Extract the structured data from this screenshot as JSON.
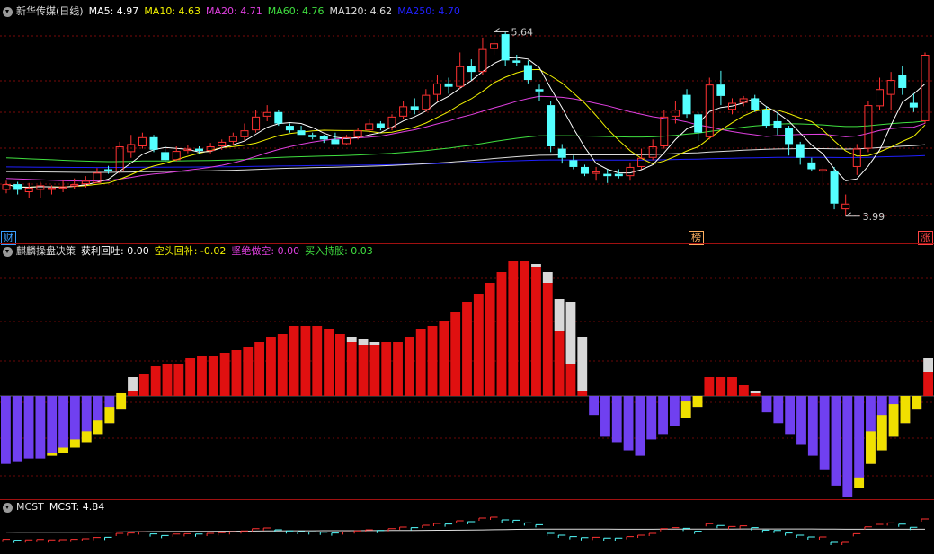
{
  "main_chart": {
    "title": "新华传媒(日线)",
    "indicators": [
      {
        "label": "MA5: 4.97",
        "color": "#ffffff"
      },
      {
        "label": "MA10: 4.63",
        "color": "#f2f200"
      },
      {
        "label": "MA20: 4.71",
        "color": "#e040e0"
      },
      {
        "label": "MA60: 4.76",
        "color": "#40e040"
      },
      {
        "label": "MA120: 4.62",
        "color": "#dddddd"
      },
      {
        "label": "MA250: 4.70",
        "color": "#2020ff"
      }
    ],
    "price_scale": [
      3.8,
      5.8
    ],
    "high_label": "5.64",
    "low_label": "3.99",
    "markers": [
      {
        "label": "财",
        "color": "#3aa0ff"
      },
      {
        "label": "榜",
        "color": "#ffb060"
      },
      {
        "label": "涨",
        "color": "#ff4444"
      }
    ],
    "candles": [
      [
        4.22,
        4.27,
        4.19,
        4.3
      ],
      [
        4.27,
        4.22,
        4.18,
        4.29
      ],
      [
        4.2,
        4.24,
        4.15,
        4.28
      ],
      [
        4.22,
        4.26,
        4.15,
        4.29
      ],
      [
        4.22,
        4.24,
        4.18,
        4.26
      ],
      [
        4.23,
        4.25,
        4.2,
        4.3
      ],
      [
        4.25,
        4.27,
        4.23,
        4.32
      ],
      [
        4.27,
        4.3,
        4.24,
        4.34
      ],
      [
        4.28,
        4.37,
        4.28,
        4.41
      ],
      [
        4.4,
        4.38,
        4.36,
        4.43
      ],
      [
        4.38,
        4.6,
        4.36,
        4.64
      ],
      [
        4.55,
        4.62,
        4.5,
        4.7
      ],
      [
        4.6,
        4.68,
        4.58,
        4.72
      ],
      [
        4.68,
        4.57,
        4.55,
        4.7
      ],
      [
        4.55,
        4.48,
        4.46,
        4.6
      ],
      [
        4.48,
        4.56,
        4.47,
        4.6
      ],
      [
        4.56,
        4.58,
        4.54,
        4.61
      ],
      [
        4.58,
        4.56,
        4.54,
        4.6
      ],
      [
        4.56,
        4.6,
        4.54,
        4.63
      ],
      [
        4.6,
        4.64,
        4.57,
        4.66
      ],
      [
        4.64,
        4.69,
        4.61,
        4.72
      ],
      [
        4.68,
        4.74,
        4.65,
        4.8
      ],
      [
        4.74,
        4.86,
        4.72,
        4.92
      ],
      [
        4.86,
        4.9,
        4.82,
        4.96
      ],
      [
        4.9,
        4.8,
        4.78,
        4.92
      ],
      [
        4.78,
        4.74,
        4.72,
        4.8
      ],
      [
        4.74,
        4.7,
        4.7,
        4.78
      ],
      [
        4.7,
        4.68,
        4.66,
        4.72
      ],
      [
        4.69,
        4.66,
        4.63,
        4.7
      ],
      [
        4.66,
        4.62,
        4.62,
        4.72
      ],
      [
        4.62,
        4.68,
        4.61,
        4.7
      ],
      [
        4.68,
        4.74,
        4.66,
        4.76
      ],
      [
        4.74,
        4.8,
        4.72,
        4.84
      ],
      [
        4.8,
        4.76,
        4.74,
        4.82
      ],
      [
        4.76,
        4.86,
        4.74,
        4.88
      ],
      [
        4.86,
        4.95,
        4.84,
        5.0
      ],
      [
        4.95,
        4.92,
        4.88,
        5.02
      ],
      [
        4.92,
        5.05,
        4.9,
        5.1
      ],
      [
        5.05,
        5.15,
        5.0,
        5.22
      ],
      [
        5.15,
        5.12,
        5.06,
        5.2
      ],
      [
        5.12,
        5.3,
        5.1,
        5.42
      ],
      [
        5.3,
        5.25,
        5.18,
        5.36
      ],
      [
        5.25,
        5.45,
        5.22,
        5.55
      ],
      [
        5.45,
        5.5,
        5.4,
        5.6
      ],
      [
        5.58,
        5.35,
        5.3,
        5.6
      ],
      [
        5.35,
        5.33,
        5.3,
        5.4
      ],
      [
        5.31,
        5.18,
        5.15,
        5.35
      ],
      [
        5.1,
        5.08,
        5.0,
        5.14
      ],
      [
        4.96,
        4.6,
        4.55,
        5.0
      ],
      [
        4.58,
        4.5,
        4.45,
        4.62
      ],
      [
        4.48,
        4.42,
        4.4,
        4.52
      ],
      [
        4.42,
        4.36,
        4.34,
        4.44
      ],
      [
        4.36,
        4.38,
        4.3,
        4.42
      ],
      [
        4.36,
        4.34,
        4.28,
        4.4
      ],
      [
        4.36,
        4.34,
        4.32,
        4.4
      ],
      [
        4.34,
        4.42,
        4.3,
        4.46
      ],
      [
        4.42,
        4.5,
        4.4,
        4.58
      ],
      [
        4.5,
        4.6,
        4.48,
        4.66
      ],
      [
        4.6,
        4.86,
        4.58,
        4.92
      ],
      [
        4.86,
        4.92,
        4.8,
        5.0
      ],
      [
        5.05,
        4.88,
        4.85,
        5.1
      ],
      [
        4.88,
        4.72,
        4.65,
        4.9
      ],
      [
        4.68,
        5.14,
        4.66,
        5.2
      ],
      [
        5.14,
        5.04,
        4.96,
        5.26
      ],
      [
        4.92,
        4.98,
        4.88,
        5.02
      ],
      [
        4.98,
        5.02,
        4.95,
        5.04
      ],
      [
        5.02,
        4.92,
        4.9,
        5.05
      ],
      [
        4.92,
        4.78,
        4.76,
        4.95
      ],
      [
        4.82,
        4.76,
        4.7,
        4.9
      ],
      [
        4.76,
        4.62,
        4.52,
        4.78
      ],
      [
        4.62,
        4.5,
        4.44,
        4.64
      ],
      [
        4.46,
        4.4,
        4.38,
        4.5
      ],
      [
        4.38,
        4.4,
        4.25,
        4.43
      ],
      [
        4.38,
        4.1,
        4.05,
        4.42
      ],
      [
        4.05,
        4.1,
        3.99,
        4.18
      ],
      [
        4.42,
        4.58,
        4.35,
        4.62
      ],
      [
        4.58,
        4.96,
        4.55,
        5.0
      ],
      [
        4.95,
        5.1,
        4.92,
        5.2
      ],
      [
        5.05,
        5.18,
        4.92,
        5.25
      ],
      [
        5.22,
        5.11,
        5.05,
        5.3
      ],
      [
        4.98,
        4.94,
        4.9,
        5.06
      ],
      [
        4.82,
        5.4,
        4.8,
        5.42
      ]
    ]
  },
  "indicator_pane": {
    "name": "麒麟操盘决策",
    "items": [
      {
        "label": "获利回吐: 0.00",
        "color": "#ffffff"
      },
      {
        "label": "空头回补: -0.02",
        "color": "#f2f200"
      },
      {
        "label": "坚绝做空: 0.00",
        "color": "#e040e0"
      },
      {
        "label": "买入持股: 0.03",
        "color": "#40e040"
      }
    ],
    "bars": [
      [
        -0.25,
        0
      ],
      [
        -0.24,
        0
      ],
      [
        -0.23,
        0
      ],
      [
        -0.23,
        0
      ],
      [
        -0.22,
        0.01
      ],
      [
        -0.21,
        0.02
      ],
      [
        -0.19,
        0.03
      ],
      [
        -0.17,
        0.04
      ],
      [
        -0.14,
        0.05
      ],
      [
        -0.1,
        0.06
      ],
      [
        -0.05,
        0.06
      ],
      [
        0.02,
        0.05
      ],
      [
        0.08,
        0
      ],
      [
        0.11,
        0
      ],
      [
        0.12,
        0
      ],
      [
        0.12,
        0
      ],
      [
        0.14,
        0
      ],
      [
        0.15,
        0
      ],
      [
        0.15,
        0
      ],
      [
        0.16,
        0
      ],
      [
        0.17,
        0
      ],
      [
        0.18,
        0
      ],
      [
        0.2,
        0
      ],
      [
        0.22,
        0
      ],
      [
        0.23,
        0
      ],
      [
        0.26,
        0
      ],
      [
        0.26,
        0
      ],
      [
        0.26,
        0
      ],
      [
        0.25,
        0
      ],
      [
        0.23,
        0
      ],
      [
        0.2,
        0.02
      ],
      [
        0.19,
        0.02
      ],
      [
        0.19,
        0.01
      ],
      [
        0.2,
        0
      ],
      [
        0.2,
        0
      ],
      [
        0.22,
        0
      ],
      [
        0.25,
        0
      ],
      [
        0.26,
        0
      ],
      [
        0.28,
        0
      ],
      [
        0.31,
        0
      ],
      [
        0.35,
        0
      ],
      [
        0.38,
        0
      ],
      [
        0.42,
        0
      ],
      [
        0.46,
        0
      ],
      [
        0.5,
        0
      ],
      [
        0.5,
        0
      ],
      [
        0.48,
        0.01
      ],
      [
        0.42,
        0.04
      ],
      [
        0.24,
        0.12
      ],
      [
        0.12,
        0.23
      ],
      [
        0.02,
        0.2
      ],
      [
        -0.07,
        0
      ],
      [
        -0.15,
        0
      ],
      [
        -0.17,
        0
      ],
      [
        -0.2,
        0
      ],
      [
        -0.22,
        0
      ],
      [
        -0.16,
        0
      ],
      [
        -0.14,
        0
      ],
      [
        -0.11,
        0
      ],
      [
        -0.08,
        0.06
      ],
      [
        -0.04,
        0.04
      ],
      [
        0.07,
        0
      ],
      [
        0.07,
        0
      ],
      [
        0.07,
        0
      ],
      [
        0.04,
        0
      ],
      [
        0.01,
        0.01
      ],
      [
        -0.06,
        0
      ],
      [
        -0.1,
        0
      ],
      [
        -0.14,
        0
      ],
      [
        -0.18,
        0
      ],
      [
        -0.22,
        0
      ],
      [
        -0.27,
        0
      ],
      [
        -0.33,
        0
      ],
      [
        -0.37,
        0
      ],
      [
        -0.34,
        0.04
      ],
      [
        -0.25,
        0.12
      ],
      [
        -0.2,
        0.13
      ],
      [
        -0.15,
        0.12
      ],
      [
        -0.1,
        0.1
      ],
      [
        -0.05,
        0.05
      ],
      [
        0.09,
        0.05
      ]
    ],
    "scale": [
      -0.37,
      0.5
    ]
  },
  "mcst_pane": {
    "name": "MCST",
    "value_label": "MCST: 4.84"
  }
}
